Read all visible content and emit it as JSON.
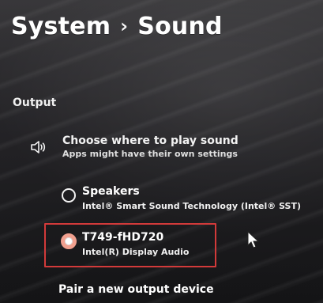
{
  "breadcrumb": {
    "parent": "System",
    "separator": "›",
    "current": "Sound"
  },
  "output": {
    "section_label": "Output",
    "choose": {
      "title": "Choose where to play sound",
      "subtitle": "Apps might have their own settings",
      "icon": "speaker-icon"
    },
    "devices": [
      {
        "name": "Speakers",
        "subtitle": "Intel® Smart Sound Technology (Intel® SST)",
        "selected": false
      },
      {
        "name": "T749-fHD720",
        "subtitle": "Intel(R) Display Audio",
        "selected": true
      }
    ],
    "pair_new_device": "Pair a new output device"
  },
  "colors": {
    "highlight_box": "#d23a3a",
    "selected_radio": "#f1a08f"
  }
}
